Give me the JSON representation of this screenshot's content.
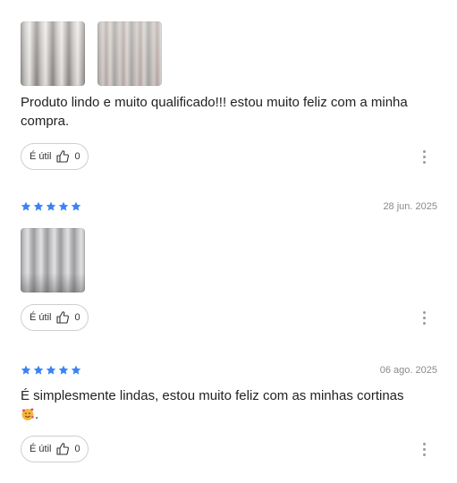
{
  "reviews": [
    {
      "photos": [
        "curtain-photo",
        "curtain-photo"
      ],
      "text": "Produto lindo e muito qualificado!!! estou muito feliz com a minha compra.",
      "useful_label": "É útil",
      "useful_count": "0"
    },
    {
      "stars": 5,
      "date": "28 jun. 2025",
      "photos": [
        "curtain-photo"
      ],
      "useful_label": "É útil",
      "useful_count": "0"
    },
    {
      "stars": 5,
      "date": "06 ago. 2025",
      "text": "É simplesmente lindas, estou muito feliz com as minhas cortinas",
      "text_end": ".",
      "emoji": "smiling-face-with-hearts-emoji",
      "useful_label": "É útil",
      "useful_count": "0"
    }
  ],
  "colors": {
    "star": "#3b82f6",
    "date": "#8a8a8a",
    "border": "#cfcfcf"
  }
}
